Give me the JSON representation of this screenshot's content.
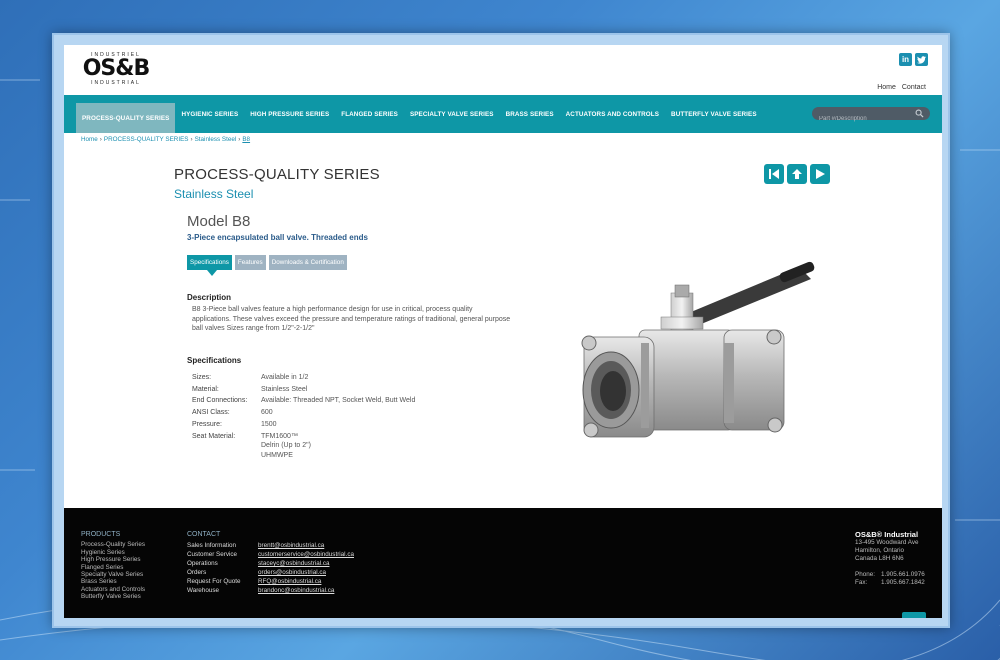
{
  "logo": {
    "top": "INDUSTRIEL",
    "main": "OS&B",
    "bottom": "INDUSTRIAL"
  },
  "social": {
    "linkedin": "in",
    "twitter": "t"
  },
  "toplinks": {
    "home": "Home",
    "contact": "Contact"
  },
  "nav": {
    "items": [
      "PROCESS-QUALITY SERIES",
      "HYGIENIC SERIES",
      "HIGH PRESSURE SERIES",
      "FLANGED SERIES",
      "SPECIALTY VALVE SERIES",
      "BRASS SERIES",
      "ACTUATORS AND CONTROLS",
      "BUTTERFLY VALVE SERIES"
    ],
    "search_placeholder": "Part #/Description"
  },
  "breadcrumb": [
    "Home",
    "PROCESS-QUALITY SERIES",
    "Stainless Steel",
    "B8"
  ],
  "breadcrumb_sep": "›",
  "page": {
    "title": "PROCESS-QUALITY SERIES",
    "subtitle": "Stainless Steel",
    "model": "Model B8",
    "tagline": "3-Piece encapsulated ball valve. Threaded ends"
  },
  "tabs": [
    "Specifications",
    "Features",
    "Downloads & Certification"
  ],
  "description": {
    "heading": "Description",
    "text": "B8 3-Piece ball valves feature a high performance design for use in critical, process quality applications. These valves exceed the pressure and temperature ratings of traditional, general purpose ball valves Sizes range from 1/2\"-2-1/2\""
  },
  "specifications": {
    "heading": "Specifications",
    "rows": [
      {
        "k": "Sizes:",
        "v": "Available in 1/2"
      },
      {
        "k": "Material:",
        "v": "Stainless Steel"
      },
      {
        "k": "End Connections:",
        "v": "Available: Threaded NPT, Socket Weld, Butt Weld"
      },
      {
        "k": "ANSI Class:",
        "v": "600"
      },
      {
        "k": "Pressure:",
        "v": "1500"
      },
      {
        "k": "Seat Material:",
        "v": "TFM1600™\nDelrin (Up to 2\")\nUHMWPE"
      }
    ]
  },
  "footer": {
    "products_heading": "PRODUCTS",
    "products": [
      "Process-Quality Series",
      "Hygienic Series",
      "High Pressure Series",
      "Flanged Series",
      "Specialty Valve Series",
      "Brass Series",
      "Actuators and Controls",
      "Butterfly Valve Series"
    ],
    "contact_heading": "CONTACT",
    "contacts": [
      {
        "label": "Sales Information",
        "email": "brentt@osbindustrial.ca"
      },
      {
        "label": "Customer Service",
        "email": "customerservice@osbindustrial.ca"
      },
      {
        "label": "Operations",
        "email": "staceyc@osbindustrial.ca"
      },
      {
        "label": "Orders",
        "email": "orders@osbindustrial.ca"
      },
      {
        "label": "Request For Quote",
        "email": "RFQ@osbindustrial.ca"
      },
      {
        "label": "Warehouse",
        "email": "brandonc@osbindustrial.ca"
      }
    ],
    "company": "OS&B® Industrial",
    "address": [
      "13-495 Woodward Ave",
      "Hamilton, Ontario",
      "Canada  L8H 6N6"
    ],
    "phone_label": "Phone:",
    "phone": "1.905.661.0976",
    "fax_label": "Fax:",
    "fax": "1.905.667.1842"
  },
  "colors": {
    "teal": "#0e97a6",
    "link": "#1b8fb0",
    "footer": "#050505"
  }
}
